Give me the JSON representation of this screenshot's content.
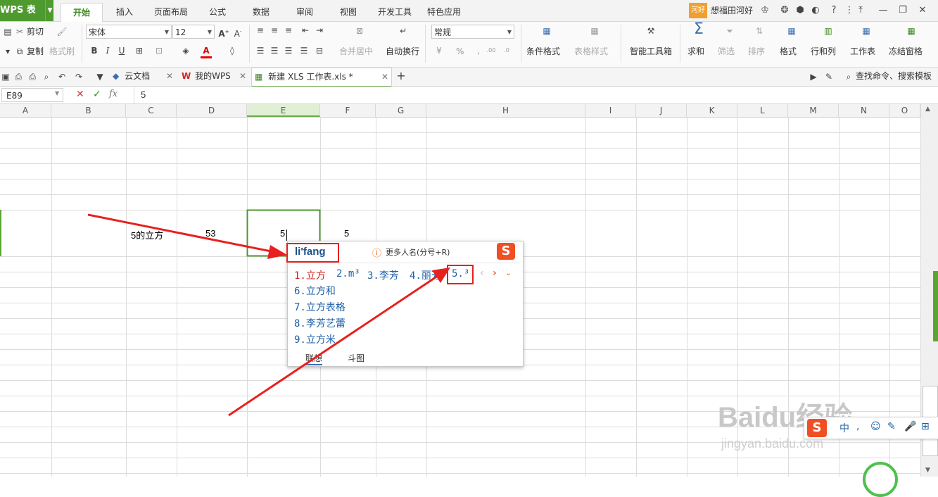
{
  "app": {
    "logo": "WPS 表格"
  },
  "menu_tabs": [
    {
      "label": "开始",
      "active": true
    },
    {
      "label": "插入"
    },
    {
      "label": "页面布局"
    },
    {
      "label": "公式"
    },
    {
      "label": "数据"
    },
    {
      "label": "审阅"
    },
    {
      "label": "视图"
    },
    {
      "label": "开发工具"
    },
    {
      "label": "特色应用"
    }
  ],
  "user": {
    "badge": "河好",
    "name": "想福田河好"
  },
  "ribbon": {
    "cut": "剪切",
    "copy": "复制",
    "format_painter": "格式刷",
    "font_name": "宋体",
    "font_size": "12",
    "merge_center": "合并居中",
    "wrap_text": "自动换行",
    "number_format": "常规",
    "percent": "%",
    "conditional_format": "条件格式",
    "table_style": "表格样式",
    "smart_toolbox": "智能工具箱",
    "sum": "求和",
    "filter": "筛选",
    "sort": "排序",
    "format": "格式",
    "rows_cols": "行和列",
    "worksheet": "工作表",
    "freeze": "冻结窗格"
  },
  "doc_tabs": [
    {
      "label": "云文档"
    },
    {
      "label": "我的WPS"
    },
    {
      "label": "新建 XLS 工作表.xls *",
      "active": true
    }
  ],
  "search": {
    "label": "查找命令、搜索模板"
  },
  "formula_bar": {
    "name_box": "E89",
    "fx": "fx",
    "content": "5"
  },
  "columns": [
    "A",
    "B",
    "C",
    "D",
    "E",
    "F",
    "G",
    "H",
    "I",
    "J",
    "K",
    "L",
    "M",
    "N",
    "O"
  ],
  "cells": {
    "c_text": "5的立方",
    "d_value": "53",
    "e_value": "5",
    "f_value": "5"
  },
  "ime": {
    "input": "li'fang",
    "hint": "更多人名(分号+R)",
    "candidates_row": [
      "1.立方",
      "2.m³",
      "3.李芳",
      "4.丽芳",
      "5.³"
    ],
    "candidates_list": [
      "6.立方和",
      "7.立方表格",
      "8.李芳艺蕾",
      "9.立方米"
    ],
    "tabs": [
      "联想",
      "斗图"
    ]
  },
  "watermark": {
    "brand": "Baidu经验",
    "url": "jingyan.baidu.com"
  },
  "colors": {
    "accent": "#6aa84f",
    "annotation": "#e8201e",
    "candidate": "#1b5fa8"
  }
}
